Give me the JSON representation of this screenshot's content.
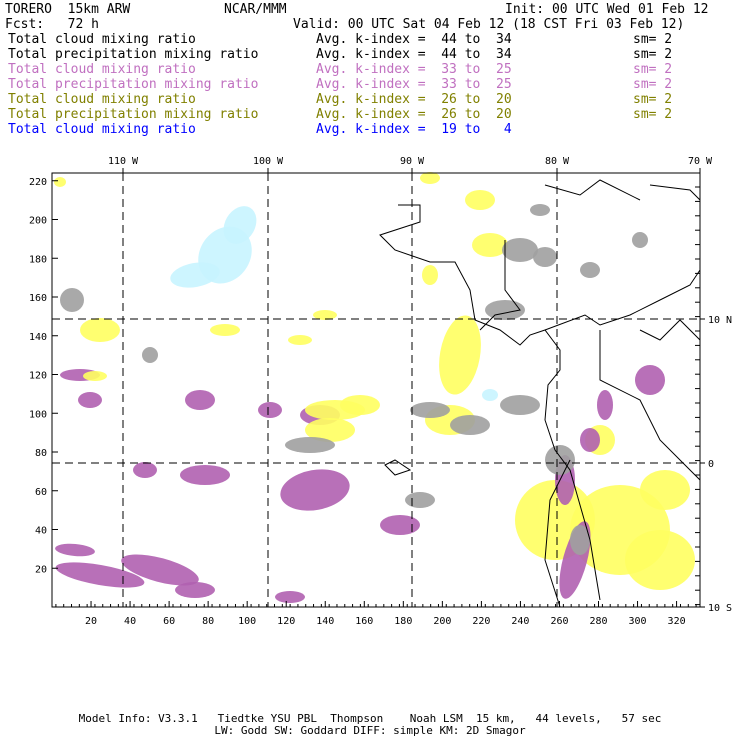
{
  "header": {
    "model": "TORERO  15km ARW",
    "org": "NCAR/MMM",
    "init": "Init: 00 UTC Wed 01 Feb 12",
    "fcst": "Fcst:   72 h",
    "valid": "Valid: 00 UTC Sat 04 Feb 12 (18 CST Fri 03 Feb 12)"
  },
  "legend": [
    {
      "field": "Total cloud mixing ratio",
      "range": "Avg. k-index =  44 to  34",
      "sm": "sm= 2",
      "color": "#000000"
    },
    {
      "field": "Total precipitation mixing ratio",
      "range": "Avg. k-index =  44 to  34",
      "sm": "sm= 2",
      "color": "#000000"
    },
    {
      "field": "Total cloud mixing ratio",
      "range": "Avg. k-index =  33 to  25",
      "sm": "sm= 2",
      "color": "#c070c0"
    },
    {
      "field": "Total precipitation mixing ratio",
      "range": "Avg. k-index =  33 to  25",
      "sm": "sm= 2",
      "color": "#c070c0"
    },
    {
      "field": "Total cloud mixing ratio",
      "range": "Avg. k-index =  26 to  20",
      "sm": "sm= 2",
      "color": "#808000"
    },
    {
      "field": "Total precipitation mixing ratio",
      "range": "Avg. k-index =  26 to  20",
      "sm": "sm= 2",
      "color": "#808000"
    },
    {
      "field": "Total cloud mixing ratio",
      "range": "Avg. k-index =  19 to   4",
      "sm": "",
      "color": "#0000ff"
    }
  ],
  "chart_data": {
    "type": "heatmap",
    "x_ticks": [
      "20",
      "40",
      "60",
      "80",
      "100",
      "120",
      "140",
      "160",
      "180",
      "200",
      "220",
      "240",
      "260",
      "280",
      "300",
      "320"
    ],
    "y_ticks": [
      "20",
      "40",
      "60",
      "80",
      "100",
      "120",
      "140",
      "160",
      "180",
      "200",
      "220"
    ],
    "lon_labels": [
      "110 W",
      "100 W",
      "90 W",
      "80 W",
      "70 W"
    ],
    "lat_labels": [
      "10 N",
      "0",
      "10 S"
    ],
    "xlim": [
      0,
      332
    ],
    "ylim": [
      0,
      224
    ],
    "fill_colors": {
      "high": "#a0a0a0",
      "mid": "#b060b0",
      "low": "#ffff60",
      "lowest": "#c8f4ff"
    }
  },
  "footer": {
    "line1": "Model Info: V3.3.1   Tiedtke YSU PBL  Thompson    Noah LSM  15 km,   44 levels,   57 sec",
    "line2": "LW: Godd SW: Goddard DIFF: simple KM: 2D Smagor"
  }
}
